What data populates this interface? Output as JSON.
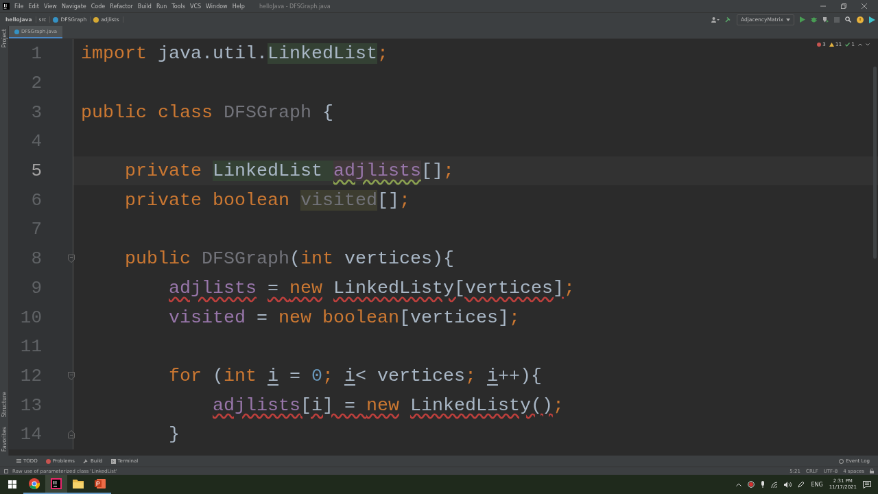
{
  "window": {
    "title": "helloJava - DFSGraph.java"
  },
  "menu": [
    "File",
    "Edit",
    "View",
    "Navigate",
    "Code",
    "Refactor",
    "Build",
    "Run",
    "Tools",
    "VCS",
    "Window",
    "Help"
  ],
  "breadcrumbs": [
    {
      "label": "helloJava",
      "kind": "project"
    },
    {
      "label": "src",
      "kind": "folder"
    },
    {
      "label": "DFSGraph",
      "kind": "class"
    },
    {
      "label": "adjlists",
      "kind": "field"
    }
  ],
  "run_config": "AdjacencyMatrix",
  "left_strip": [
    "Project",
    "Structure",
    "Favorites"
  ],
  "tabs": [
    {
      "label": "DFSGraph.java",
      "selected": true
    }
  ],
  "inspections": {
    "errors": "3",
    "warnings": "11",
    "ok": "1"
  },
  "lines": [
    {
      "number": "1",
      "current": false,
      "kind": "code",
      "tokens": [
        {
          "text": "import",
          "kind": "keyword"
        },
        {
          "text": " java.util.",
          "kind": "plain"
        },
        {
          "text": "LinkedList",
          "kind": "usage"
        },
        {
          "text": ";",
          "kind": "keyword"
        }
      ]
    },
    {
      "number": "2",
      "current": false,
      "kind": "code"
    },
    {
      "number": "3",
      "current": false,
      "kind": "code",
      "tokens": [
        {
          "text": "public class ",
          "kind": "keyword"
        },
        {
          "text": "DFSGraph",
          "kind": "unused-name"
        },
        {
          "text": " {",
          "kind": "plain"
        }
      ]
    },
    {
      "number": "4",
      "current": false,
      "kind": "code"
    },
    {
      "number": "5",
      "current": true,
      "kind": "code",
      "tokens": [
        {
          "text": "    private ",
          "kind": "keyword"
        },
        {
          "text": "LinkedList ",
          "kind": "usage"
        },
        {
          "text": "adjlists",
          "kind": "field-warning"
        },
        {
          "text": "[]",
          "kind": "plain"
        },
        {
          "text": ";",
          "kind": "keyword"
        }
      ]
    },
    {
      "number": "6",
      "current": false,
      "kind": "code",
      "tokens": [
        {
          "text": "    private boolean ",
          "kind": "keyword"
        },
        {
          "text": "visited",
          "kind": "unused-field"
        },
        {
          "text": "[]",
          "kind": "plain"
        },
        {
          "text": ";",
          "kind": "keyword"
        }
      ]
    },
    {
      "number": "7",
      "current": false,
      "kind": "code"
    },
    {
      "number": "8",
      "current": false,
      "kind": "fold-start",
      "tokens": [
        {
          "text": "    public ",
          "kind": "keyword"
        },
        {
          "text": "DFSGraph",
          "kind": "unused-name"
        },
        {
          "text": "(",
          "kind": "plain"
        },
        {
          "text": "int ",
          "kind": "keyword"
        },
        {
          "text": "vertices){",
          "kind": "plain"
        }
      ]
    },
    {
      "number": "9",
      "current": false,
      "kind": "code",
      "tokens": [
        {
          "text": "        adjlists",
          "kind": "error-field"
        },
        {
          "text": " = ",
          "kind": "error-plain"
        },
        {
          "text": "new",
          "kind": "error-keyword"
        },
        {
          "text": " LinkedListy[vertices]",
          "kind": "error-plain"
        },
        {
          "text": ";",
          "kind": "keyword"
        }
      ]
    },
    {
      "number": "10",
      "current": false,
      "kind": "code",
      "tokens": [
        {
          "text": "        visited",
          "kind": "field"
        },
        {
          "text": " = ",
          "kind": "plain"
        },
        {
          "text": "new boolean",
          "kind": "keyword"
        },
        {
          "text": "[vertices]",
          "kind": "plain"
        },
        {
          "text": ";",
          "kind": "keyword"
        }
      ]
    },
    {
      "number": "11",
      "current": false,
      "kind": "code"
    },
    {
      "number": "12",
      "current": false,
      "kind": "fold-start",
      "tokens": [
        {
          "text": "        for",
          "kind": "keyword"
        },
        {
          "text": " (",
          "kind": "plain"
        },
        {
          "text": "int ",
          "kind": "keyword"
        },
        {
          "text": "i",
          "kind": "reassigned"
        },
        {
          "text": " = ",
          "kind": "plain"
        },
        {
          "text": "0",
          "kind": "number"
        },
        {
          "text": "; ",
          "kind": "keyword"
        },
        {
          "text": "i",
          "kind": "reassigned"
        },
        {
          "text": "< vertices",
          "kind": "plain"
        },
        {
          "text": "; ",
          "kind": "keyword"
        },
        {
          "text": "i",
          "kind": "reassigned"
        },
        {
          "text": "++){",
          "kind": "plain"
        }
      ]
    },
    {
      "number": "13",
      "current": false,
      "kind": "code",
      "tokens": [
        {
          "text": "            adjlists",
          "kind": "error-field"
        },
        {
          "text": "[i] = ",
          "kind": "error-plain"
        },
        {
          "text": "new",
          "kind": "error-keyword"
        },
        {
          "text": " LinkedListy()",
          "kind": "error-plain"
        },
        {
          "text": ";",
          "kind": "keyword"
        }
      ]
    },
    {
      "number": "14",
      "current": false,
      "kind": "fold-end",
      "tokens": [
        {
          "text": "        }",
          "kind": "plain"
        }
      ]
    }
  ],
  "tool_windows": [
    {
      "label": "TODO",
      "kind": "list"
    },
    {
      "label": "Problems",
      "kind": "problems"
    },
    {
      "label": "Build",
      "kind": "hammer"
    },
    {
      "label": "Terminal",
      "kind": "terminal"
    }
  ],
  "event_log": "Event Log",
  "status": {
    "message": "Raw use of parameterized class 'LinkedList'",
    "position": "5:21",
    "line_separator": "CRLF",
    "encoding": "UTF-8",
    "indent": "4 spaces"
  },
  "taskbar": {
    "apps": [
      {
        "kind": "chrome",
        "selected": false
      },
      {
        "kind": "intellij",
        "selected": true
      },
      {
        "kind": "explorer",
        "selected": false
      },
      {
        "kind": "powerpoint",
        "selected": false
      }
    ],
    "language": "ENG",
    "time": "2:31 PM",
    "date": "11/17/2021"
  }
}
